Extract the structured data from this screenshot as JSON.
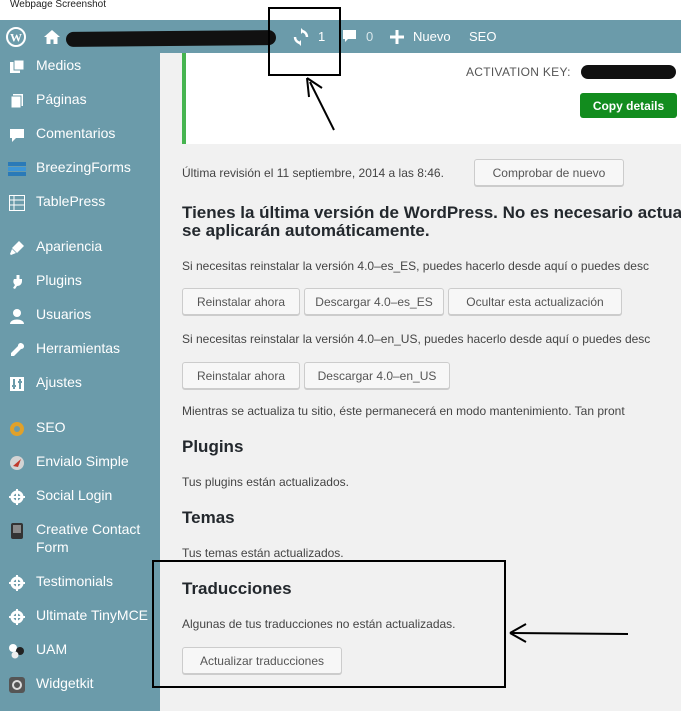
{
  "screenshot_caption": "Webpage Screenshot",
  "adminbar": {
    "updates_count": "1",
    "comments_count": "0",
    "new_label": "Nuevo",
    "seo_label": "SEO"
  },
  "sidebar": {
    "items": [
      {
        "label": "Medios",
        "icon": "media-icon"
      },
      {
        "label": "Páginas",
        "icon": "pages-icon"
      },
      {
        "label": "Comentarios",
        "icon": "comments-icon"
      },
      {
        "label": "BreezingForms",
        "icon": "breezingforms-icon"
      },
      {
        "label": "TablePress",
        "icon": "tablepress-icon"
      },
      {
        "label": "Apariencia",
        "icon": "appearance-icon"
      },
      {
        "label": "Plugins",
        "icon": "plugins-icon"
      },
      {
        "label": "Usuarios",
        "icon": "users-icon"
      },
      {
        "label": "Herramientas",
        "icon": "tools-icon"
      },
      {
        "label": "Ajustes",
        "icon": "settings-icon"
      },
      {
        "label": "SEO",
        "icon": "seo-icon"
      },
      {
        "label": "Envialo Simple",
        "icon": "envialo-icon"
      },
      {
        "label": "Social Login",
        "icon": "social-login-icon"
      },
      {
        "label": "Creative Contact Form",
        "icon": "contact-form-icon"
      },
      {
        "label": "Testimonials",
        "icon": "testimonials-icon"
      },
      {
        "label": "Ultimate TinyMCE",
        "icon": "tinymce-icon"
      },
      {
        "label": "UAM",
        "icon": "uam-icon"
      },
      {
        "label": "Widgetkit",
        "icon": "widgetkit-icon"
      }
    ]
  },
  "activation": {
    "key_label": "ACTIVATION KEY:",
    "copy_button": "Copy details"
  },
  "main": {
    "last_check": "Última revisión el 11 septiembre, 2014 a las 8:46.",
    "check_again_button": "Comprobar de nuevo",
    "latest_heading_line1": "Tienes la última versión de WordPress. No es necesario actua",
    "latest_heading_line2": "se aplicarán automáticamente.",
    "reinstall_es_text": "Si necesitas reinstalar la versión 4.0–es_ES, puedes hacerlo desde aquí o puedes desc",
    "reinstall_button": "Reinstalar ahora",
    "download_es_button": "Descargar 4.0–es_ES",
    "hide_update_button": "Ocultar esta actualización",
    "reinstall_en_text": "Si necesitas reinstalar la versión 4.0–en_US, puedes hacerlo desde aquí o puedes desc",
    "reinstall_button_2": "Reinstalar ahora",
    "download_en_button": "Descargar 4.0–en_US",
    "maintenance_text": "Mientras se actualiza tu sitio, éste permanecerá en modo mantenimiento. Tan pront",
    "plugins_heading": "Plugins",
    "plugins_text": "Tus plugins están actualizados.",
    "themes_heading": "Temas",
    "themes_text": "Tus temas están actualizados.",
    "translations_heading": "Traducciones",
    "translations_text": "Algunas de tus traducciones no están actualizadas.",
    "update_translations_button": "Actualizar traducciones"
  },
  "colors": {
    "admin_bar": "#6b9baa",
    "sidebar": "#6b9baa",
    "copy_button": "#128c1e",
    "notice_border": "#46b450"
  }
}
